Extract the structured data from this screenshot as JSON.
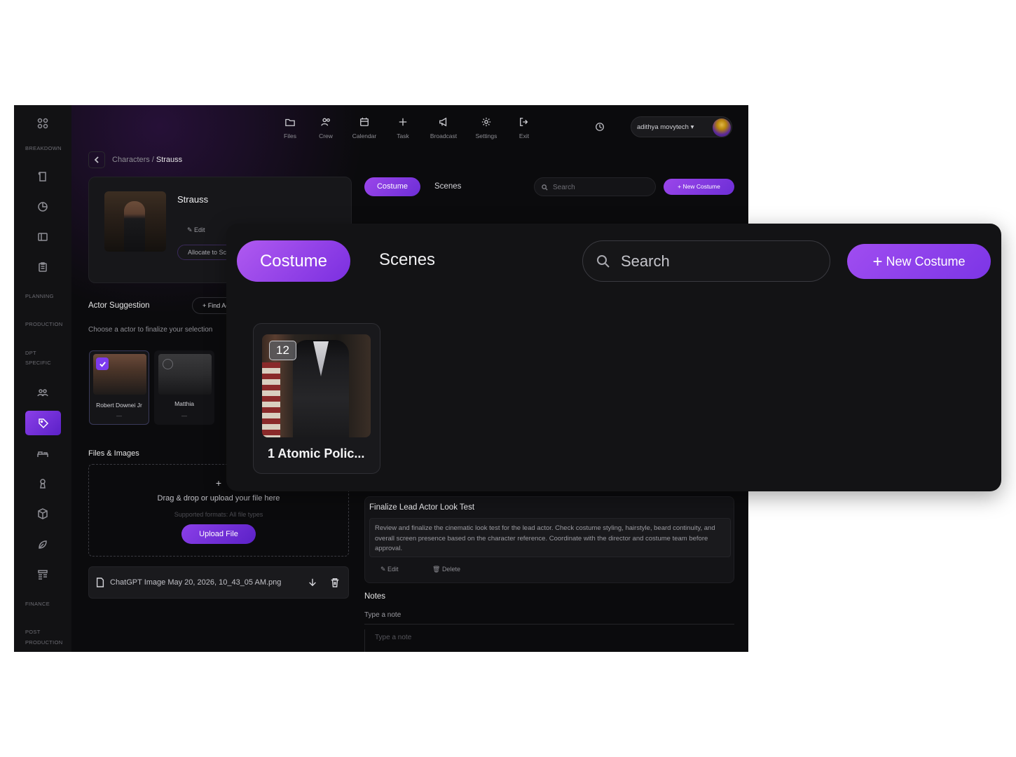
{
  "topnav": {
    "items": [
      {
        "label": "Files",
        "icon": "folder-icon"
      },
      {
        "label": "Crew",
        "icon": "crew-icon"
      },
      {
        "label": "Calendar",
        "icon": "calendar-icon"
      },
      {
        "label": "Task",
        "icon": "plus-icon"
      },
      {
        "label": "Broadcast",
        "icon": "megaphone-icon"
      },
      {
        "label": "Settings",
        "icon": "gear-icon"
      },
      {
        "label": "Exit",
        "icon": "exit-icon"
      }
    ],
    "user_name": "adithya movytech"
  },
  "sidebar": {
    "sections": {
      "breakdown": "BREAKDOWN",
      "planning": "PLANNING",
      "production": "PRODUCTION",
      "dpt_specific_1": "DPT",
      "dpt_specific_2": "SPECIFIC",
      "finance": "FINANCE",
      "post_production_1": "POST",
      "post_production_2": "PRODUCTION"
    }
  },
  "breadcrumb": {
    "parent": "Characters",
    "separator": "/",
    "current": "Strauss"
  },
  "character": {
    "name": "Strauss",
    "edit_label": "Edit",
    "allocate_label": "Allocate to Scenes"
  },
  "actor_suggestion": {
    "title": "Actor Suggestion",
    "find_label": "+ Find Actor",
    "subtitle": "Choose a actor to finalize your selection",
    "actors": [
      {
        "name": "Robert Downei Jr",
        "dash": "—",
        "selected": true
      },
      {
        "name": "Matthia",
        "dash": "—",
        "selected": false
      }
    ]
  },
  "files": {
    "title": "Files & Images",
    "plus": "+",
    "drop_text": "Drag & drop or upload your file here",
    "supported": "Supported formats: All file types",
    "upload_label": "Upload File",
    "file_name": "ChatGPT Image May 20, 2026, 10_43_05 AM.png"
  },
  "costume_tabs": {
    "costume_label": "Costume",
    "scenes_label": "Scenes",
    "search_placeholder": "Search",
    "new_costume_label": "+ New Costume"
  },
  "task": {
    "title": "Finalize Lead Actor Look Test",
    "description": "Review and finalize the cinematic look test for the lead actor. Check costume styling, hairstyle, beard continuity, and overall screen presence based on the character reference. Coordinate with the director and costume team before approval.",
    "edit_label": "Edit",
    "delete_label": "Delete"
  },
  "notes": {
    "title": "Notes",
    "subtitle": "Type a note",
    "placeholder": "Type a note"
  },
  "overlay": {
    "costume_label": "Costume",
    "scenes_label": "Scenes",
    "search_placeholder": "Search",
    "new_costume_label": "New Costume",
    "card": {
      "badge": "12",
      "title": "1 Atomic Polic..."
    }
  },
  "colors": {
    "accent": "#8b3fe8",
    "accent_dark": "#5b21c7",
    "background": "#0b0b0d"
  }
}
